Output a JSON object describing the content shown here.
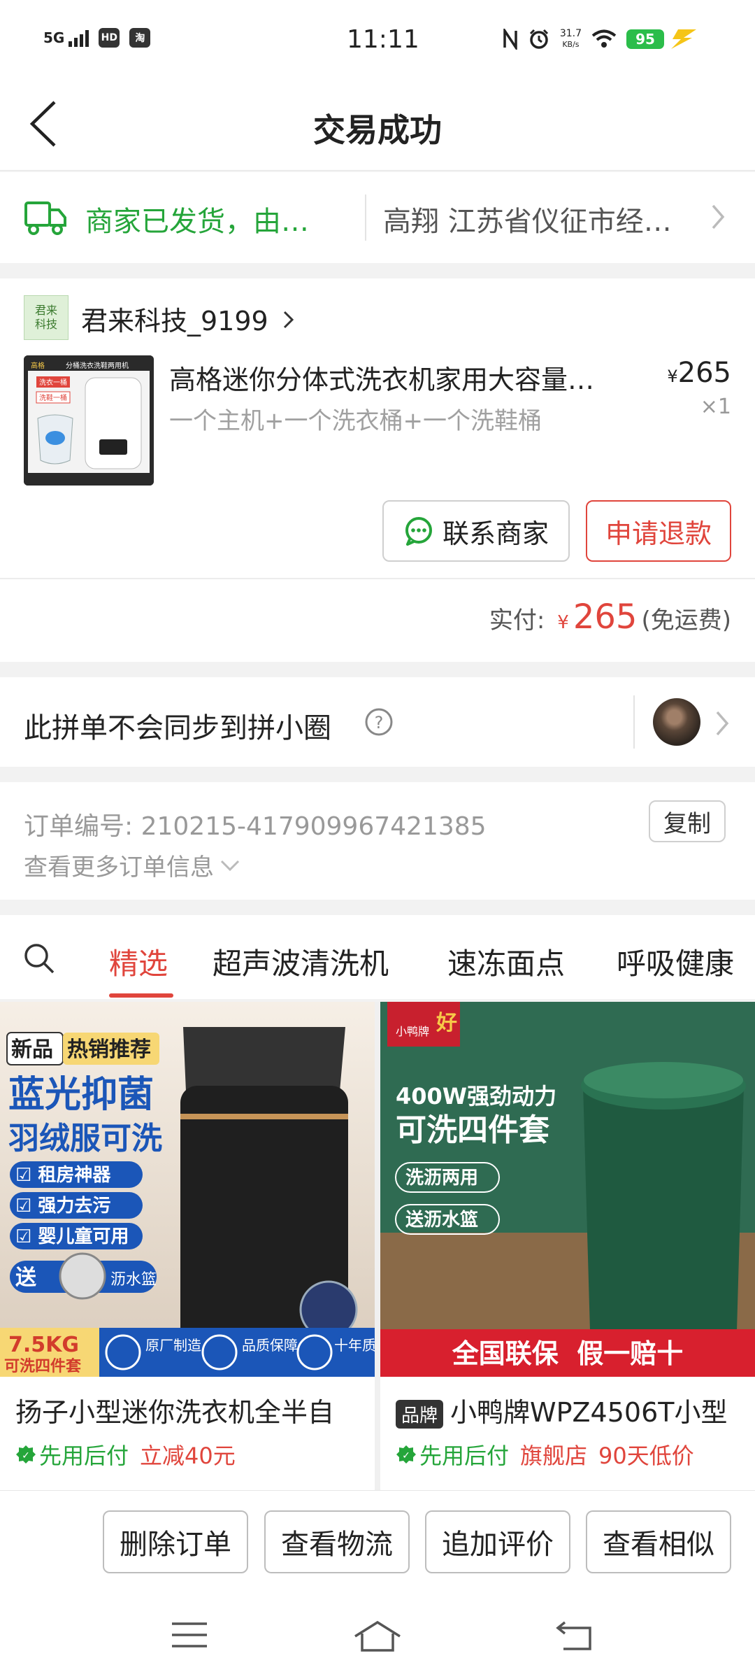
{
  "status_bar": {
    "network": "5G",
    "hd_badge": "HD",
    "app_badge": "淘",
    "time": "11:11",
    "net_speed_value": "31.7",
    "net_speed_unit": "KB/s",
    "battery": "95"
  },
  "header": {
    "title": "交易成功"
  },
  "shipping": {
    "status": "商家已发货，由…",
    "address": "高翔 江苏省仪征市经…"
  },
  "store": {
    "logo_text": "君来科技",
    "name": "君来科技_9199"
  },
  "product": {
    "title": "高格迷你分体式洗衣机家用大容量…",
    "spec": "一个主机+一个洗衣桶+一个洗鞋桶",
    "price_symbol": "¥",
    "price": "265",
    "quantity": "×1",
    "thumb_banner": "分桶洗衣洗鞋两用机",
    "thumb_tag1": "洗衣一桶",
    "thumb_tag2": "洗鞋一桶",
    "thumb_brand": "高格"
  },
  "actions": {
    "contact_seller": "联系商家",
    "request_refund": "申请退款"
  },
  "payment": {
    "label": "实付:",
    "symbol": "¥",
    "amount": "265",
    "note": "(免运费)"
  },
  "group_sync": {
    "text": "此拼单不会同步到拼小圈",
    "help": "?"
  },
  "order": {
    "number_label": "订单编号:",
    "number": "210215-417909967421385",
    "copy_label": "复制",
    "more_info": "查看更多订单信息"
  },
  "tabs": [
    {
      "label": "精选",
      "active": true
    },
    {
      "label": "超声波清洗机",
      "active": false
    },
    {
      "label": "速冻面点",
      "active": false
    },
    {
      "label": "呼吸健康",
      "active": false
    }
  ],
  "recommendations": [
    {
      "title": "扬子小型迷你洗衣机全半自",
      "tags": [
        "先用后付",
        "立减40元"
      ],
      "img": {
        "badge_new": "新品",
        "badge_hot": "热销推荐",
        "headline1": "蓝光抑菌",
        "headline2": "羽绒服可洗",
        "checks": [
          "租房神器",
          "强力去污",
          "婴儿童可用"
        ],
        "gift": "送",
        "gift_item": "沥水篮",
        "capacity": "7.5KG",
        "capacity_sub": "可洗四件套",
        "features": [
          "原厂制造",
          "品质保障",
          "十年质保"
        ]
      }
    },
    {
      "brand_badge": "品牌",
      "title": "小鸭牌WPZ4506T小型",
      "tags": [
        "先用后付",
        "旗舰店",
        "90天低价"
      ],
      "img": {
        "brand": "小鸭牌",
        "brand_mark": "好",
        "headline1": "400W强劲动力",
        "headline2": "可洗四件套",
        "pills": [
          "洗沥两用",
          "送沥水篮"
        ],
        "banner": "全国联保  假一赔十"
      }
    }
  ],
  "bottom_actions": [
    "删除订单",
    "查看物流",
    "追加评价",
    "查看相似"
  ],
  "colors": {
    "accent_red": "#e0453c",
    "success_green": "#25a53a"
  }
}
